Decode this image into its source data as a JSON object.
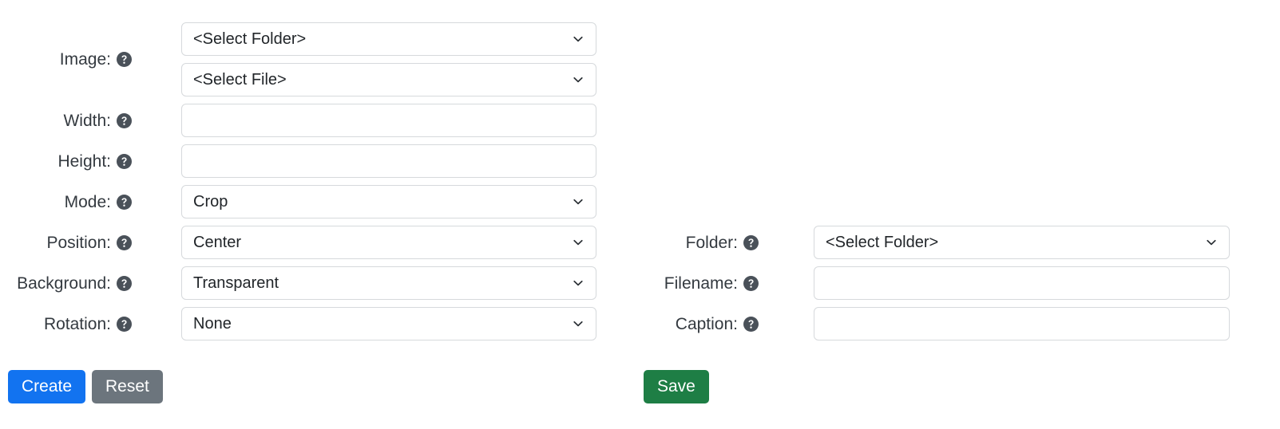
{
  "form": {
    "left_column": {
      "fields": [
        {
          "label": "Image:",
          "help_icon": "question-circle-icon",
          "controls": [
            {
              "type": "select",
              "name": "image-folder",
              "value": "<Select Folder>"
            },
            {
              "type": "select",
              "name": "image-file",
              "value": "<Select File>"
            }
          ]
        },
        {
          "label": "Width:",
          "help_icon": "question-circle-icon",
          "controls": [
            {
              "type": "text",
              "name": "width",
              "value": "",
              "placeholder": ""
            }
          ]
        },
        {
          "label": "Height:",
          "help_icon": "question-circle-icon",
          "controls": [
            {
              "type": "text",
              "name": "height",
              "value": "",
              "placeholder": ""
            }
          ]
        },
        {
          "label": "Mode:",
          "help_icon": "question-circle-icon",
          "controls": [
            {
              "type": "select",
              "name": "mode",
              "value": "Crop"
            }
          ]
        },
        {
          "label": "Position:",
          "help_icon": "question-circle-icon",
          "controls": [
            {
              "type": "select",
              "name": "position",
              "value": "Center"
            }
          ]
        },
        {
          "label": "Background:",
          "help_icon": "question-circle-icon",
          "controls": [
            {
              "type": "select",
              "name": "background",
              "value": "Transparent"
            }
          ]
        },
        {
          "label": "Rotation:",
          "help_icon": "question-circle-icon",
          "controls": [
            {
              "type": "select",
              "name": "rotation",
              "value": "None"
            }
          ]
        }
      ],
      "buttons": [
        {
          "name": "create",
          "label": "Create",
          "color": "#1273f0"
        },
        {
          "name": "reset",
          "label": "Reset",
          "color": "#6c757d"
        }
      ]
    },
    "right_column": {
      "fields": [
        {
          "label": "Folder:",
          "help_icon": "question-circle-icon",
          "controls": [
            {
              "type": "select",
              "name": "save-folder",
              "value": "<Select Folder>"
            }
          ]
        },
        {
          "label": "Filename:",
          "help_icon": "question-circle-icon",
          "controls": [
            {
              "type": "text",
              "name": "filename",
              "value": "",
              "placeholder": ""
            }
          ]
        },
        {
          "label": "Caption:",
          "help_icon": "question-circle-icon",
          "controls": [
            {
              "type": "text",
              "name": "caption",
              "value": "",
              "placeholder": ""
            }
          ]
        }
      ],
      "buttons": [
        {
          "name": "save",
          "label": "Save",
          "color": "#1e7e45"
        }
      ]
    }
  },
  "theme": {
    "label_color": "#343a40",
    "border_color": "#d6d9dc",
    "help_icon_color": "#4a5159",
    "background": "#ffffff"
  }
}
